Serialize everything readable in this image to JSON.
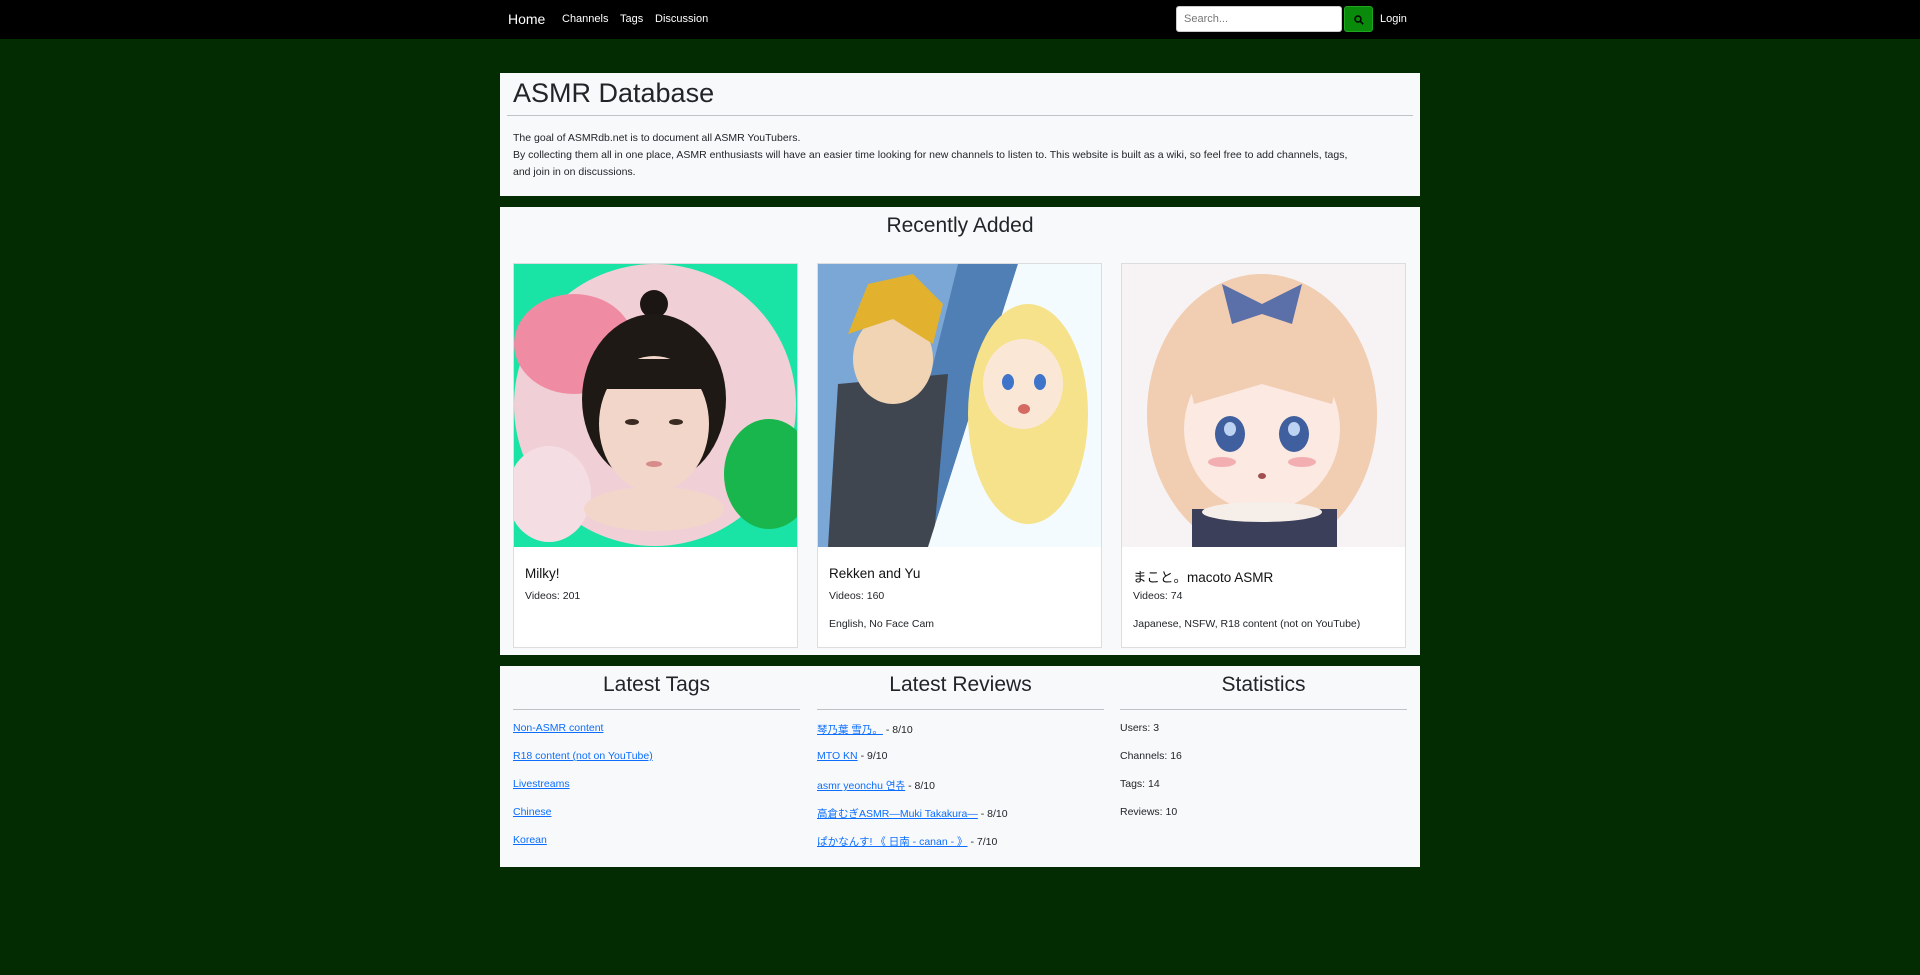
{
  "nav": {
    "brand": "Home",
    "links": [
      "Channels",
      "Tags",
      "Discussion"
    ],
    "search_placeholder": "Search...",
    "login": "Login"
  },
  "intro": {
    "title": "ASMR Database",
    "line1": "The goal of ASMRdb.net is to document all ASMR YouTubers.",
    "line2": "By collecting them all in one place, ASMR enthusiasts will have an easier time looking for new channels to listen to. This website is built as a wiki, so feel free to add channels, tags,",
    "line3": "and join in on discussions."
  },
  "recent": {
    "title": "Recently Added",
    "cards": [
      {
        "name": "Milky!",
        "videos": "Videos: 201",
        "tags": ""
      },
      {
        "name": "Rekken and Yu",
        "videos": "Videos: 160",
        "tags": "English, No Face Cam"
      },
      {
        "name": "まこと。macoto ASMR",
        "videos": "Videos: 74",
        "tags": "Japanese, NSFW, R18 content (not on YouTube)"
      }
    ]
  },
  "latest_tags": {
    "title": "Latest Tags",
    "items": [
      "Non-ASMR content",
      "R18 content (not on YouTube)",
      "Livestreams",
      "Chinese",
      "Korean"
    ]
  },
  "latest_reviews": {
    "title": "Latest Reviews",
    "items": [
      {
        "channel": "琴乃葉 雪乃。",
        "score": " - 8/10"
      },
      {
        "channel": "MTO KN",
        "score": " - 9/10"
      },
      {
        "channel": "asmr yeonchu 연츄",
        "score": " - 8/10"
      },
      {
        "channel": "高倉むぎASMR―Muki Takakura―",
        "score": " - 8/10"
      },
      {
        "channel": "ぱかなんす! 《 日南 - canan - 》",
        "score": " - 7/10"
      }
    ]
  },
  "statistics": {
    "title": "Statistics",
    "items": [
      "Users: 3",
      "Channels: 16",
      "Tags: 14",
      "Reviews: 10"
    ]
  },
  "colors": {
    "page_background": "#032c03",
    "navbar": "#000000",
    "search_button": "#0a8a0a",
    "link": "#0d6efd"
  }
}
